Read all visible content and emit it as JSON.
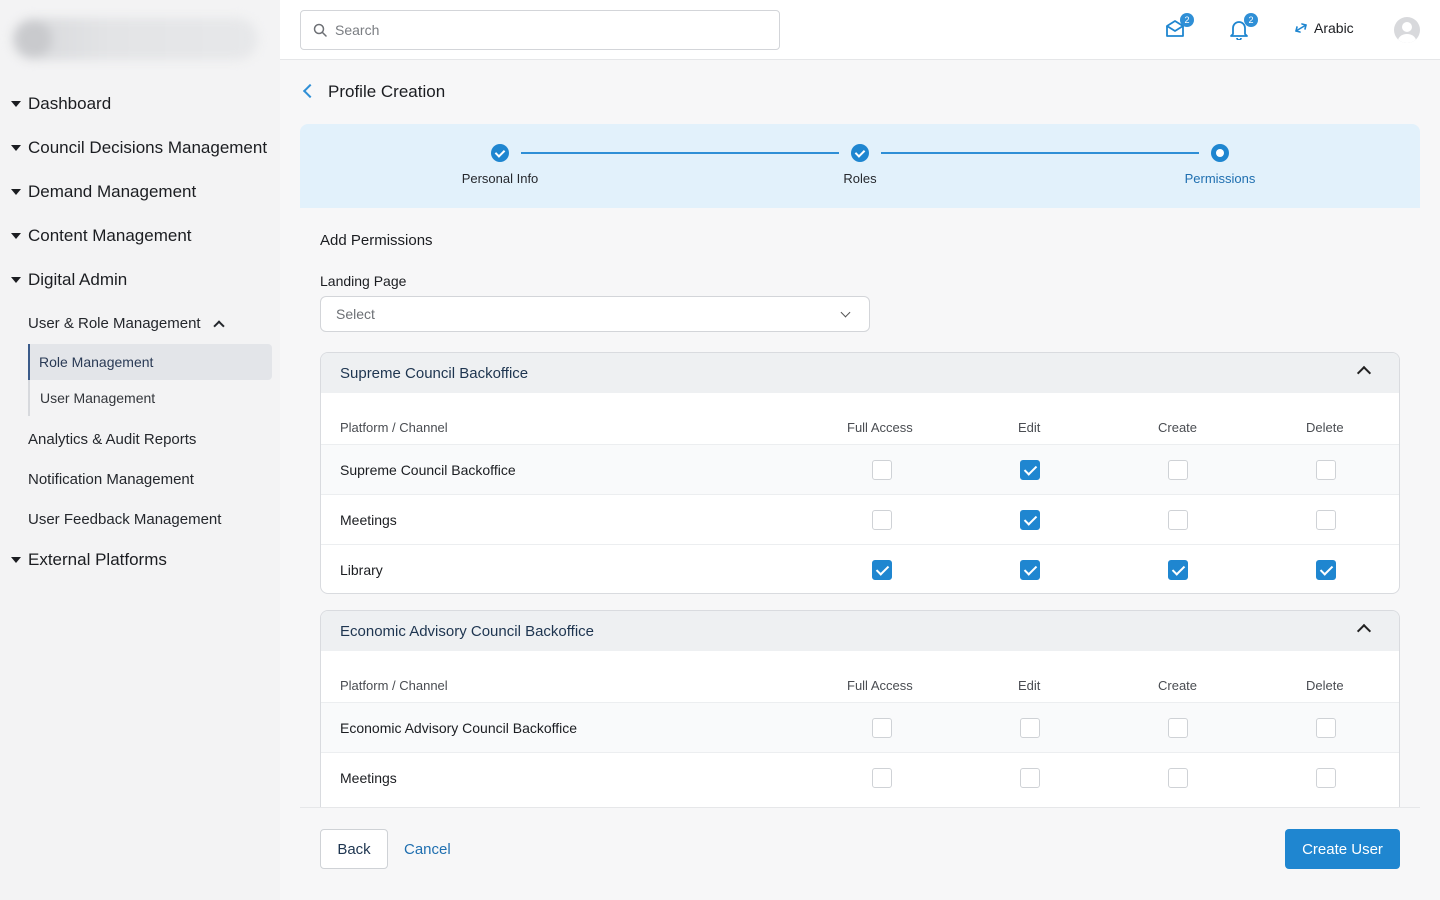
{
  "search": {
    "placeholder": "Search"
  },
  "header": {
    "mail_badge": "2",
    "notification_badge": "2",
    "language_label": "Arabic"
  },
  "sidebar": {
    "items": [
      {
        "label": "Dashboard"
      },
      {
        "label": "Council Decisions Management"
      },
      {
        "label": "Demand Management"
      },
      {
        "label": "Content Management"
      },
      {
        "label": "Digital Admin"
      },
      {
        "label": "External Platforms"
      }
    ],
    "digital_admin_sub": {
      "group_label": "User & Role Management",
      "group_children": [
        "Role Management",
        "User Management"
      ],
      "others": [
        "Analytics & Audit Reports",
        "Notification Management",
        "User Feedback Management"
      ]
    }
  },
  "page": {
    "title": "Profile Creation"
  },
  "stepper": {
    "steps": [
      {
        "label": "Personal Info",
        "state": "done"
      },
      {
        "label": "Roles",
        "state": "done"
      },
      {
        "label": "Permissions",
        "state": "current"
      }
    ]
  },
  "form": {
    "section_title": "Add Permissions",
    "landing_page_label": "Landing Page",
    "landing_page_value": "Select"
  },
  "columns": {
    "channel": "Platform / Channel",
    "full_access": "Full Access",
    "edit": "Edit",
    "create": "Create",
    "delete": "Delete"
  },
  "panels": [
    {
      "title": "Supreme Council Backoffice",
      "rows": [
        {
          "label": "Supreme Council Backoffice",
          "full_access": false,
          "edit": true,
          "create": false,
          "delete": false
        },
        {
          "label": "Meetings",
          "full_access": false,
          "edit": true,
          "create": false,
          "delete": false
        },
        {
          "label": "Library",
          "full_access": true,
          "edit": true,
          "create": true,
          "delete": true
        }
      ]
    },
    {
      "title": "Economic Advisory Council Backoffice",
      "rows": [
        {
          "label": "Economic Advisory Council Backoffice",
          "full_access": false,
          "edit": false,
          "create": false,
          "delete": false
        },
        {
          "label": "Meetings",
          "full_access": false,
          "edit": false,
          "create": false,
          "delete": false
        }
      ]
    }
  ],
  "footer": {
    "back_label": "Back",
    "cancel_label": "Cancel",
    "create_label": "Create User"
  },
  "colors": {
    "accent": "#1f86d0",
    "stepper_bg": "#e2f1fb",
    "sidebar_bg": "#f3f3f4"
  }
}
